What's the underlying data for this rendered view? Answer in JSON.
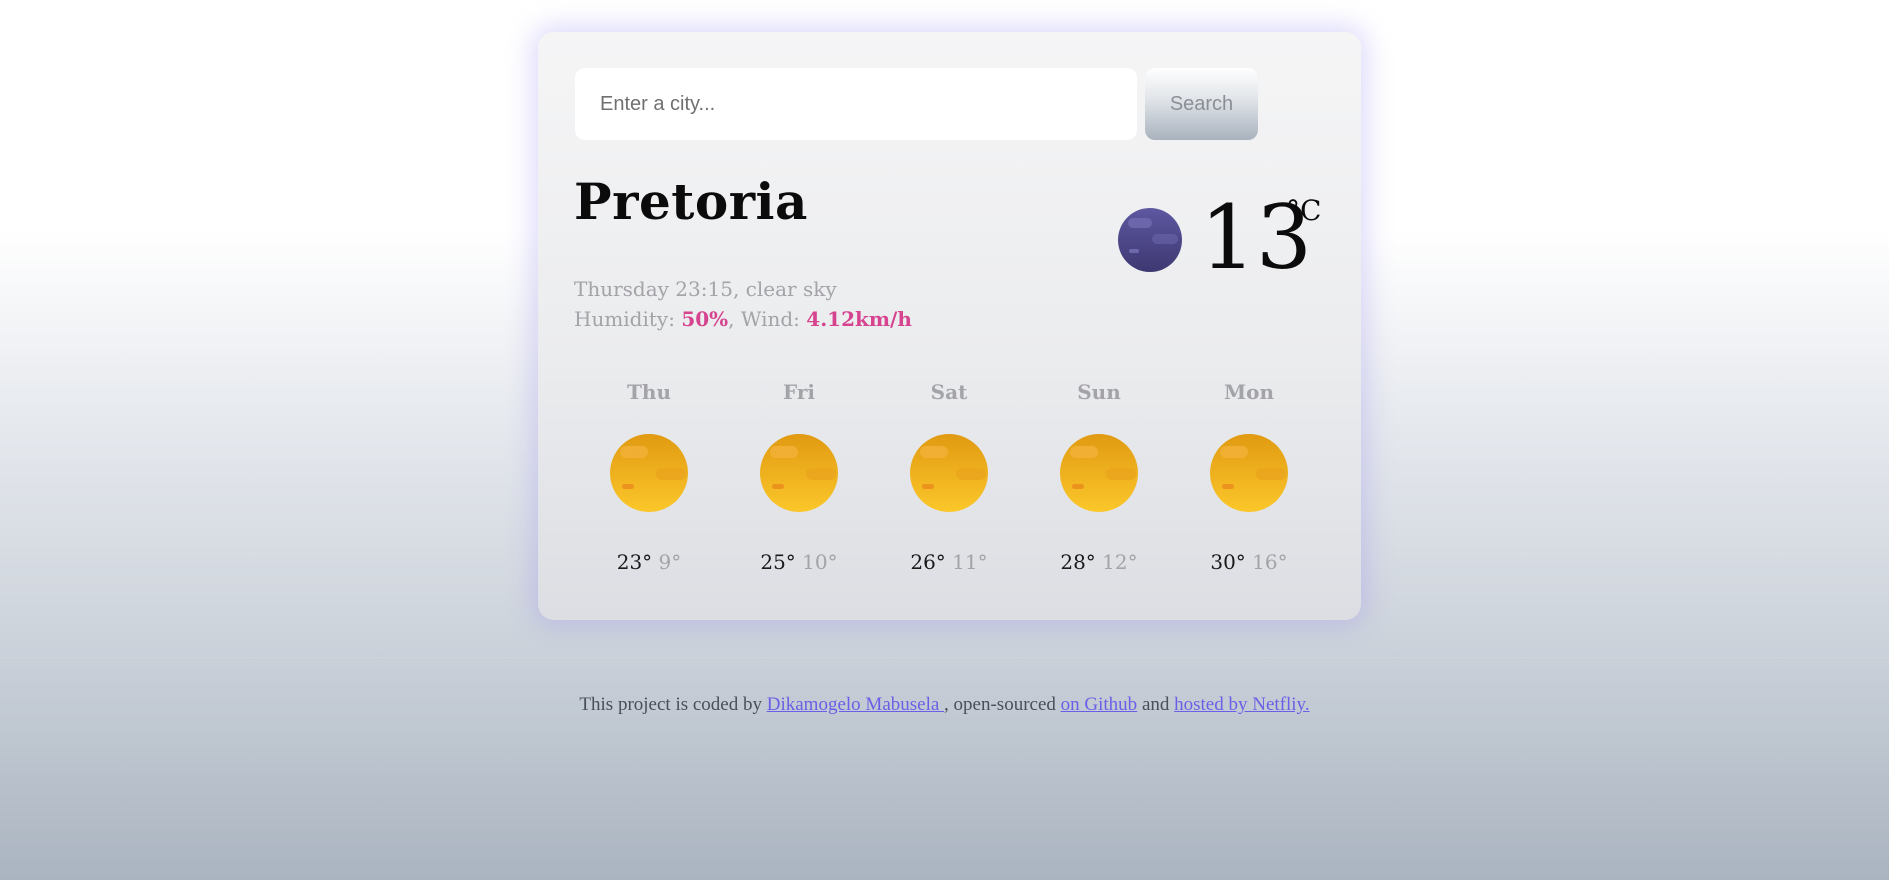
{
  "search": {
    "placeholder": "Enter a city...",
    "button_label": "Search"
  },
  "current": {
    "city": "Pretoria",
    "day_time": "Thursday 23:15",
    "description": "clear sky",
    "humidity_label": "Humidity:",
    "humidity": "50%",
    "wind_label": "Wind:",
    "wind": "4.12km/h",
    "temperature": "13",
    "unit": "°C",
    "icon": "moon-icon"
  },
  "forecast": [
    {
      "day": "Thu",
      "max": "23°",
      "min": "9°",
      "icon": "sun-icon"
    },
    {
      "day": "Fri",
      "max": "25°",
      "min": "10°",
      "icon": "sun-icon"
    },
    {
      "day": "Sat",
      "max": "26°",
      "min": "11°",
      "icon": "sun-icon"
    },
    {
      "day": "Sun",
      "max": "28°",
      "min": "12°",
      "icon": "sun-icon"
    },
    {
      "day": "Mon",
      "max": "30°",
      "min": "16°",
      "icon": "sun-icon"
    }
  ],
  "footer": {
    "prefix": "This project is coded by",
    "author_link": "Dikamogelo Mabusela ",
    "middle": ", open-sourced",
    "github_link": "on Github",
    "and": "and",
    "netlify_link": "hosted by Netfliy."
  },
  "colors": {
    "highlight": "#d6448f",
    "link": "#6c5fe7",
    "moon": "#4a4486",
    "sun": "#f5b51c"
  }
}
